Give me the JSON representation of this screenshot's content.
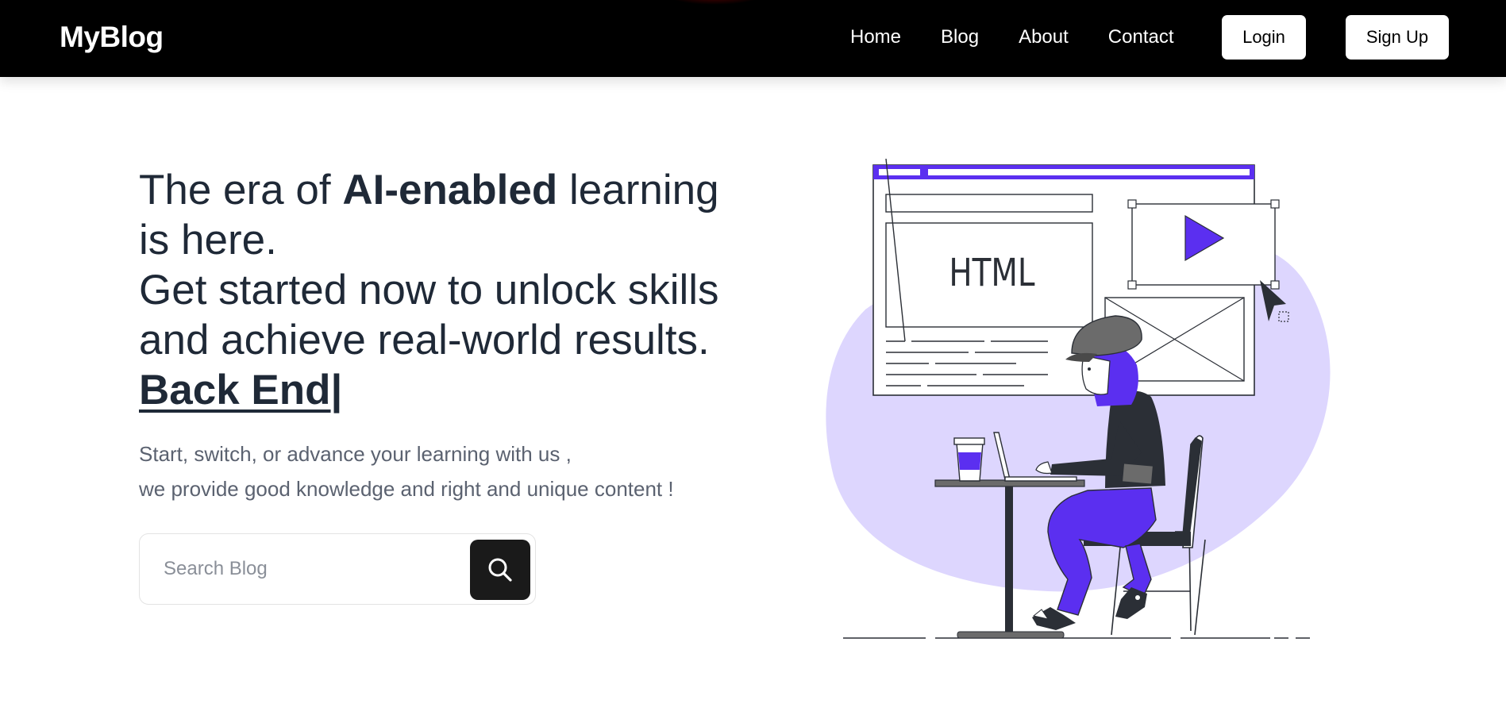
{
  "nav": {
    "brand": "MyBlog",
    "links": [
      "Home",
      "Blog",
      "About",
      "Contact"
    ],
    "login_label": "Login",
    "signup_label": "Sign Up"
  },
  "hero": {
    "title_part1": "The era of ",
    "title_bold": "AI-enabled",
    "title_part2": " learning is here.",
    "title_part3": "Get started now to unlock skills and achieve real-world results. ",
    "typed_text": "Back End",
    "cursor": "|",
    "subtitle_line1": "Start, switch, or advance your learning with us ,",
    "subtitle_line2": "we provide good knowledge and right and unique content !"
  },
  "search": {
    "placeholder": "Search Blog",
    "value": ""
  },
  "illustration": {
    "label": "HTML",
    "icons": [
      "search-icon",
      "play-icon",
      "cursor-arrow-icon"
    ]
  },
  "colors": {
    "nav_bg": "#000000",
    "accent": "#5b2ff0",
    "blob": "#ddd6fe",
    "text_dark": "#1f2937",
    "text_muted": "#5b6270"
  }
}
